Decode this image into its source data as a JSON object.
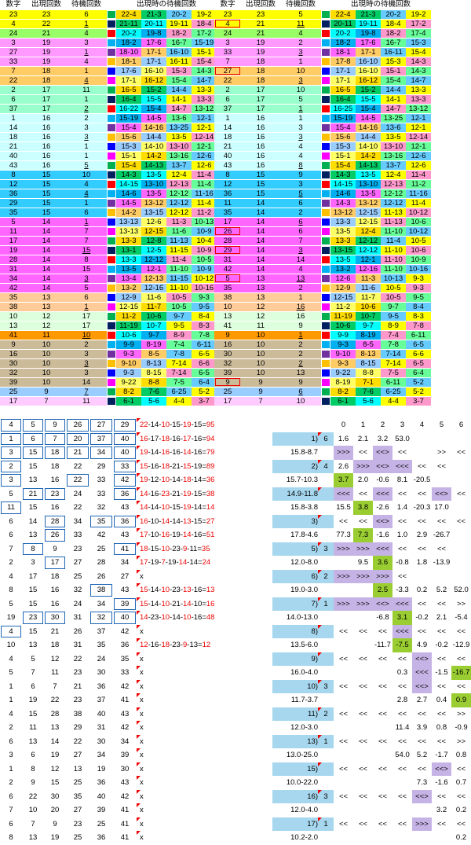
{
  "headers": {
    "num": "数字",
    "appear": "出現回数",
    "wait": "待機回数",
    "wait_at": "出現時の待機回数"
  },
  "left_rows": [
    [
      "23",
      "23",
      "6",
      "",
      "22-4",
      "21-3",
      "20-2",
      "19-2"
    ],
    [
      "4",
      "22",
      "1",
      "",
      "21-11",
      "20-11",
      "19-11",
      "18-4"
    ],
    [
      "24",
      "21",
      "4",
      "",
      "20-2",
      "19-8",
      "18-2",
      "17-2"
    ],
    [
      "3",
      "19",
      "3",
      "",
      "18-2",
      "17-6",
      "16-7",
      "15-19"
    ],
    [
      "27",
      "19",
      "1",
      "",
      "18-10",
      "17-1",
      "16-10",
      "15-1"
    ],
    [
      "33",
      "19",
      "4",
      "",
      "18-1",
      "17-1",
      "16-11",
      "15-4"
    ],
    [
      "7",
      "18",
      "1",
      "",
      "17-6",
      "16-10",
      "15-3",
      "14-3"
    ],
    [
      "22",
      "18",
      "4",
      "",
      "17-1",
      "16-12",
      "15-4",
      "14-7"
    ],
    [
      "2",
      "17",
      "11",
      "",
      "16-5",
      "15-2",
      "14-4",
      "13-3"
    ],
    [
      "6",
      "17",
      "1",
      "",
      "16-4",
      "15-5",
      "14-1",
      "13-3"
    ],
    [
      "37",
      "17",
      "2",
      "",
      "16-22",
      "15-4",
      "14-7",
      "13-12"
    ],
    [
      "1",
      "16",
      "2",
      "",
      "15-19",
      "14-5",
      "13-6",
      "12-1"
    ],
    [
      "14",
      "16",
      "3",
      "",
      "15-4",
      "14-16",
      "13-25",
      "12-1"
    ],
    [
      "18",
      "16",
      "3",
      "",
      "15-6",
      "14-4",
      "13-5",
      "12-14"
    ],
    [
      "21",
      "16",
      "1",
      "",
      "15-3",
      "14-10",
      "13-10",
      "12-1"
    ],
    [
      "40",
      "16",
      "1",
      "",
      "15-1",
      "14-2",
      "13-16",
      "12-6"
    ],
    [
      "43",
      "16",
      "5",
      "",
      "15-4",
      "14-13",
      "13-7",
      "12-6"
    ],
    [
      "8",
      "15",
      "10",
      "",
      "14-3",
      "13-5",
      "12-4",
      "11-4"
    ],
    [
      "12",
      "15",
      "4",
      "",
      "14-15",
      "13-10",
      "12-13",
      "11-4"
    ],
    [
      "36",
      "15",
      "4",
      "",
      "14-6",
      "13-5",
      "12-12",
      "11-16"
    ],
    [
      "29",
      "15",
      "1",
      "",
      "14-5",
      "13-12",
      "12-12",
      "11-4"
    ],
    [
      "35",
      "15",
      "6",
      "",
      "14-2",
      "13-15",
      "12-12",
      "11-2"
    ],
    [
      "5",
      "14",
      "1",
      "",
      "13-13",
      "12-6",
      "11-3",
      "10-13"
    ],
    [
      "11",
      "14",
      "7",
      "",
      "13-13",
      "12-15",
      "11-6",
      "10-9"
    ],
    [
      "17",
      "14",
      "7",
      "",
      "13-3",
      "12-8",
      "11-13",
      "10-4"
    ],
    [
      "19",
      "14",
      "15",
      "",
      "13-1",
      "12-5",
      "11-15",
      "10-9"
    ],
    [
      "28",
      "14",
      "8",
      "",
      "13-3",
      "12-12",
      "11-4",
      "10-5"
    ],
    [
      "31",
      "14",
      "15",
      "",
      "13-5",
      "12-1",
      "11-10",
      "10-9"
    ],
    [
      "34",
      "14",
      "3",
      "",
      "13-4",
      "12-13",
      "11-15",
      "10-12"
    ],
    [
      "42",
      "14",
      "5",
      "",
      "13-2",
      "12-16",
      "11-10",
      "10-16"
    ],
    [
      "35",
      "13",
      "6",
      "",
      "12-9",
      "11-6",
      "10-5",
      "9-3"
    ],
    [
      "38",
      "13",
      "1",
      "",
      "12-15",
      "11-7",
      "10-5",
      "9-5"
    ],
    [
      "10",
      "12",
      "17",
      "",
      "11-2",
      "10-6",
      "9-7",
      "8-4"
    ],
    [
      "13",
      "12",
      "17",
      "",
      "11-19",
      "10-7",
      "9-5",
      "8-3"
    ],
    [
      "41",
      "11",
      "10",
      "",
      "10-6",
      "9-7",
      "8-9",
      "7-8"
    ],
    [
      "9",
      "10",
      "2",
      "",
      "9-9",
      "8-19",
      "7-4",
      "6-11"
    ],
    [
      "16",
      "10",
      "3",
      "",
      "9-3",
      "8-5",
      "7-8",
      "6-5"
    ],
    [
      "30",
      "10",
      "3",
      "",
      "9-10",
      "8-13",
      "7-14",
      "6-6"
    ],
    [
      "32",
      "10",
      "3",
      "",
      "9-3",
      "8-15",
      "7-14",
      "6-5"
    ],
    [
      "39",
      "10",
      "14",
      "",
      "9-22",
      "8-8",
      "7-5",
      "6-4"
    ],
    [
      "25",
      "9",
      "7",
      "",
      "8-2",
      "7-6",
      "6-25",
      "5-2"
    ],
    [
      "17",
      "7",
      "11",
      "",
      "6-1",
      "5-6",
      "4-4",
      "3-7"
    ]
  ],
  "right_rows": [
    [
      "23",
      "23",
      "5",
      "",
      "22-4",
      "21-3",
      "20-2",
      "19-2"
    ],
    [
      "4",
      "21",
      "11",
      "",
      "20-11",
      "19-11",
      "18-4",
      "17-2"
    ],
    [
      "24",
      "21",
      "4",
      "",
      "20-2",
      "19-8",
      "18-2",
      "17-4"
    ],
    [
      "3",
      "19",
      "2",
      "",
      "18-2",
      "17-6",
      "16-7",
      "15-3"
    ],
    [
      "33",
      "19",
      "3",
      "",
      "18-1",
      "17-1",
      "16-11",
      "15-4"
    ],
    [
      "7",
      "18",
      "1",
      "",
      "17-8",
      "16-10",
      "15-3",
      "14-3"
    ],
    [
      "27",
      "18",
      "10",
      "",
      "17-1",
      "16-10",
      "15-1",
      "14-3"
    ],
    [
      "22",
      "18",
      "3",
      "",
      "17-1",
      "16-12",
      "15-4",
      "14-7"
    ],
    [
      "2",
      "17",
      "10",
      "",
      "16-5",
      "15-2",
      "14-4",
      "13-3"
    ],
    [
      "6",
      "17",
      "5",
      "",
      "16-4",
      "15-5",
      "14-1",
      "13-3"
    ],
    [
      "37",
      "17",
      "1",
      "",
      "16-25",
      "15-4",
      "14-7",
      "13-12"
    ],
    [
      "1",
      "16",
      "1",
      "",
      "15-19",
      "14-5",
      "13-25",
      "12-1"
    ],
    [
      "14",
      "16",
      "3",
      "",
      "15-4",
      "14-16",
      "13-6",
      "12-1"
    ],
    [
      "18",
      "16",
      "3",
      "",
      "15-6",
      "14-4",
      "13-5",
      "12-14"
    ],
    [
      "21",
      "16",
      "4",
      "",
      "15-3",
      "14-10",
      "13-10",
      "12-1"
    ],
    [
      "40",
      "16",
      "4",
      "",
      "15-1",
      "14-2",
      "13-16",
      "12-6"
    ],
    [
      "43",
      "16",
      "8",
      "",
      "15-4",
      "14-13",
      "13-7",
      "12-6"
    ],
    [
      "8",
      "15",
      "9",
      "",
      "14-3",
      "13-5",
      "12-4",
      "11-4"
    ],
    [
      "12",
      "15",
      "3",
      "",
      "14-15",
      "13-10",
      "12-13",
      "11-2"
    ],
    [
      "36",
      "15",
      "5",
      "",
      "14-6",
      "13-5",
      "12-12",
      "11-16"
    ],
    [
      "11",
      "14",
      "6",
      "",
      "14-3",
      "13-12",
      "12-12",
      "11-4"
    ],
    [
      "35",
      "14",
      "2",
      "",
      "13-12",
      "12-15",
      "11-13",
      "10-12"
    ],
    [
      "17",
      "14",
      "6",
      "",
      "13-3",
      "12-15",
      "11-13",
      "10-6"
    ],
    [
      "26",
      "14",
      "6",
      "",
      "13-5",
      "12-4",
      "11-10",
      "10-12"
    ],
    [
      "28",
      "14",
      "7",
      "",
      "13-3",
      "12-12",
      "11-4",
      "10-5"
    ],
    [
      "29",
      "14",
      "3",
      "",
      "13-15",
      "12-12",
      "11-10",
      "10-6"
    ],
    [
      "31",
      "14",
      "14",
      "",
      "13-5",
      "12-1",
      "11-10",
      "10-9"
    ],
    [
      "42",
      "14",
      "4",
      "",
      "13-2",
      "12-16",
      "11-10",
      "10-16"
    ],
    [
      "5",
      "13",
      "13",
      "",
      "12-6",
      "11-3",
      "10-13",
      "9-3"
    ],
    [
      "35",
      "13",
      "2",
      "",
      "12-9",
      "11-6",
      "10-5",
      "9-3"
    ],
    [
      "38",
      "13",
      "1",
      "",
      "12-15",
      "11-7",
      "10-5",
      "9-5"
    ],
    [
      "10",
      "12",
      "16",
      "",
      "11-2",
      "10-6",
      "9-7",
      "8-4"
    ],
    [
      "13",
      "12",
      "16",
      "",
      "11-19",
      "10-7",
      "9-5",
      "8-3"
    ],
    [
      "41",
      "11",
      "9",
      "",
      "10-6",
      "9-7",
      "8-9",
      "7-8"
    ],
    [
      "9",
      "10",
      "1",
      "",
      "9-9",
      "8-19",
      "7-4",
      "6-11"
    ],
    [
      "16",
      "10",
      "2",
      "",
      "9-3",
      "8-5",
      "7-8",
      "6-5"
    ],
    [
      "30",
      "10",
      "2",
      "",
      "9-10",
      "8-13",
      "7-14",
      "6-6"
    ],
    [
      "32",
      "10",
      "2",
      "",
      "9-3",
      "8-15",
      "7-14",
      "6-5"
    ],
    [
      "39",
      "10",
      "13",
      "",
      "9-22",
      "8-8",
      "7-5",
      "6-4"
    ],
    [
      "9",
      "9",
      "9",
      "",
      "8-19",
      "7-1",
      "6-11",
      "5-2"
    ],
    [
      "25",
      "9",
      "6",
      "",
      "8-2",
      "7-6",
      "6-25",
      "5-2"
    ],
    [
      "17",
      "7",
      "10",
      "",
      "6-1",
      "5-6",
      "4-4",
      "3-7"
    ]
  ],
  "bottom_nums": [
    [
      "4",
      "5",
      "9",
      "26",
      "27",
      "29"
    ],
    [
      "1",
      "6",
      "7",
      "20",
      "37",
      "40"
    ],
    [
      "3",
      "15",
      "18",
      "21",
      "34",
      "40"
    ],
    [
      "2",
      "15",
      "18",
      "22",
      "29",
      "33"
    ],
    [
      "3",
      "13",
      "16",
      "22",
      "33",
      "42"
    ],
    [
      "5",
      "21",
      "23",
      "24",
      "33",
      "36"
    ],
    [
      "11",
      "15",
      "16",
      "22",
      "32",
      "43"
    ],
    [
      "6",
      "14",
      "28",
      "34",
      "35",
      "36"
    ],
    [
      "6",
      "13",
      "26",
      "33",
      "42",
      "43"
    ],
    [
      "7",
      "8",
      "9",
      "23",
      "25",
      "41"
    ],
    [
      "2",
      "3",
      "17",
      "27",
      "28",
      "34"
    ],
    [
      "4",
      "17",
      "18",
      "25",
      "26",
      "27"
    ],
    [
      "8",
      "15",
      "16",
      "32",
      "38",
      "43"
    ],
    [
      "5",
      "15",
      "16",
      "24",
      "34",
      "39"
    ],
    [
      "19",
      "23",
      "30",
      "31",
      "32",
      "40"
    ],
    [
      "4",
      "15",
      "21",
      "26",
      "37",
      "42"
    ],
    [
      "10",
      "13",
      "18",
      "31",
      "35",
      "36"
    ],
    [
      "4",
      "5",
      "12",
      "22",
      "24",
      "35"
    ],
    [
      "5",
      "7",
      "11",
      "23",
      "30",
      "33"
    ],
    [
      "1",
      "6",
      "7",
      "21",
      "36",
      "42"
    ],
    [
      "1",
      "19",
      "22",
      "23",
      "37",
      "41"
    ],
    [
      "4",
      "15",
      "28",
      "38",
      "40",
      "43"
    ],
    [
      "2",
      "11",
      "13",
      "29",
      "31",
      "42"
    ],
    [
      "6",
      "13",
      "14",
      "22",
      "30",
      "34"
    ],
    [
      "3",
      "6",
      "19",
      "27",
      "34",
      "39"
    ],
    [
      "1",
      "8",
      "12",
      "13",
      "19",
      "30"
    ],
    [
      "2",
      "9",
      "15",
      "25",
      "36",
      "43"
    ],
    [
      "6",
      "22",
      "30",
      "35",
      "40",
      "42"
    ],
    [
      "7",
      "10",
      "20",
      "27",
      "39",
      "41"
    ],
    [
      "6",
      "7",
      "9",
      "23",
      "25",
      "41"
    ],
    [
      "8",
      "13",
      "19",
      "25",
      "36",
      "41"
    ]
  ],
  "bottom_seq": [
    "22-14-10-15-19-15=95",
    "16-17-18-16-17-16=94",
    "19-14-16-16-14-16=79",
    "15-16-18-21-15-19=89",
    "19-12-10-14-18-14=36",
    "14-16-23-21-19-15=38",
    "14-14-10-15-19-14=14",
    "16-10-14-14-13-15=27",
    "17-10-16-19-14-16=51",
    "18-15-10-23-9-11=35",
    "17-19-7-19-14-14=24",
    "x",
    "15-14-10-23-13-16=13",
    "15-14-10-21-14-10=16",
    "14-23-10-14-10-16=48",
    "x",
    "12-16-18-23-9-13=12",
    "x",
    "x",
    "x",
    "x",
    "x",
    "x",
    "x",
    "x",
    "x",
    "x",
    "x",
    "x",
    "x",
    "x"
  ],
  "ana_head": [
    "0",
    "1",
    "2",
    "3",
    "4",
    "5",
    "6"
  ],
  "ana_rows": [
    {
      "lbl": "1)",
      "n": "6",
      "r": "",
      "v": [
        "1.6",
        "2.1",
        "3.2",
        "53.0",
        "",
        "",
        ""
      ]
    },
    {
      "lbl": "15.8-8.7",
      "n": "",
      "r": "",
      "v": [
        ">>>",
        "<<",
        "<<>",
        "<<",
        "",
        ">>",
        "<<"
      ]
    },
    {
      "lbl": "2)",
      "n": "4",
      "r": "",
      "v": [
        "2.6",
        ">>>",
        "<<>",
        "<<<",
        "<<",
        "<<",
        ""
      ]
    },
    {
      "lbl": "15.7-10.3",
      "n": "",
      "r": "",
      "v": [
        "3.7",
        "2.0",
        "-0.6",
        "8.1",
        "-20.5",
        "",
        ""
      ]
    },
    {
      "lbl": "14.9-11.8",
      "n": "",
      "r": "",
      "v": [
        "<<<",
        "<<",
        "<<<",
        "<<",
        "<<",
        "<<>",
        "<<"
      ]
    },
    {
      "lbl": "15.8-3.8",
      "n": "",
      "r": "",
      "v": [
        "15.5",
        "3.8",
        "-2.6",
        "1.4",
        "-20.3",
        "17.0",
        ""
      ]
    },
    {
      "lbl": "3)",
      "n": "",
      "r": "",
      "v": [
        "<<",
        "<<",
        "<<>",
        "<<",
        "<<",
        "<<",
        "<<"
      ]
    },
    {
      "lbl": "17.8-4.6",
      "n": "",
      "r": "",
      "v": [
        "77.3",
        "7.3",
        "-1.6",
        "1.0",
        "2.9",
        "-26.7",
        ""
      ]
    },
    {
      "lbl": "5)",
      "n": "3",
      "r": "",
      "v": [
        ">>>",
        ">>>",
        "<<<",
        "<<",
        "<<",
        "<<",
        ""
      ]
    },
    {
      "lbl": "12.0-8.0",
      "n": "",
      "r": "",
      "v": [
        "",
        "9.5",
        "3.6",
        "-0.8",
        "1.8",
        "-13.9",
        ""
      ]
    },
    {
      "lbl": "6)",
      "n": "2",
      "r": "",
      "v": [
        ">>>",
        ">>>",
        ">>>",
        "<<",
        "",
        "",
        ""
      ]
    },
    {
      "lbl": "19.0-3.0",
      "n": "",
      "r": "",
      "v": [
        "",
        "",
        "2.5",
        "-3.3",
        "0.2",
        "5.2",
        "52.0"
      ]
    },
    {
      "lbl": "7)",
      "n": "1",
      "r": "",
      "v": [
        ">>>",
        ">>>",
        "<<>",
        "<<<",
        "<<",
        "<<",
        ">>"
      ]
    },
    {
      "lbl": "14.0-13.0",
      "n": "",
      "r": "",
      "v": [
        "",
        "",
        "-6.8",
        "3.1",
        "-0.2",
        "2.1",
        "-5.4"
      ]
    },
    {
      "lbl": "8)",
      "n": "",
      "r": "",
      "v": [
        "<<",
        "<<",
        "<<",
        "<<<",
        "<<",
        "<<",
        "<<"
      ]
    },
    {
      "lbl": "13.5-6.0",
      "n": "",
      "r": "",
      "v": [
        "",
        "",
        "-11.7",
        "-7.5",
        "4.9",
        "-0.2",
        "-12.9"
      ]
    },
    {
      "lbl": "9)",
      "n": "",
      "r": "",
      "v": [
        "<<",
        "<<",
        "<<",
        "<<",
        "<<>",
        "<<",
        "<<"
      ]
    },
    {
      "lbl": "16.0-4.0",
      "n": "",
      "r": "",
      "v": [
        "",
        "",
        "",
        "0.3",
        "<<<",
        "-1.5",
        "-16.7"
      ]
    },
    {
      "lbl": "10)",
      "n": "3",
      "r": "",
      "v": [
        "<<",
        "<<",
        "<<",
        "<<",
        "<<>",
        "<<",
        "<<"
      ]
    },
    {
      "lbl": "11.7-3.7",
      "n": "",
      "r": "",
      "v": [
        "",
        "",
        "",
        "2.8",
        "2.7",
        "0.4",
        "0.9"
      ]
    },
    {
      "lbl": "11)",
      "n": "2",
      "r": "",
      "v": [
        "<<",
        "<<",
        "<<",
        "<<",
        "<<",
        "<<",
        ">>"
      ]
    },
    {
      "lbl": "12.0-3.0",
      "n": "",
      "r": "",
      "v": [
        "",
        "",
        "",
        "11.4",
        "3.9",
        "0.8",
        "-0.9"
      ]
    },
    {
      "lbl": "13)",
      "n": "1",
      "r": "",
      "v": [
        "<<",
        "<<",
        "<<",
        "<<",
        "<<",
        "<<",
        ">>"
      ]
    },
    {
      "lbl": "13.0-25.0",
      "n": "",
      "r": "",
      "v": [
        "",
        "",
        "",
        "54.0",
        "5.2",
        "-1.7",
        "0.8"
      ]
    },
    {
      "lbl": "15)",
      "n": "",
      "r": "",
      "v": [
        "<<",
        "<<",
        "<<",
        "<<",
        "<<",
        "<<>",
        "<<"
      ]
    },
    {
      "lbl": "10.0-22.0",
      "n": "",
      "r": "",
      "v": [
        "",
        "",
        "",
        "",
        "7.3",
        "-1.6",
        "0.7"
      ]
    },
    {
      "lbl": "16)",
      "n": "3",
      "r": "",
      "v": [
        "<<",
        "<<",
        "<<",
        "<<",
        "<<>",
        "<<",
        "<<"
      ]
    },
    {
      "lbl": "12.0-4.0",
      "n": "",
      "r": "",
      "v": [
        "",
        "",
        "",
        "",
        "",
        "3.2",
        "0.2"
      ]
    },
    {
      "lbl": "17)",
      "n": "1",
      "r": "",
      "v": [
        "<<",
        "<<",
        "<<",
        "<<",
        ">>>",
        "<<",
        "<<"
      ]
    },
    {
      "lbl": "10.2-2.0",
      "n": "",
      "r": "",
      "v": [
        "",
        "",
        "",
        "",
        "",
        "",
        "0.2"
      ]
    }
  ]
}
